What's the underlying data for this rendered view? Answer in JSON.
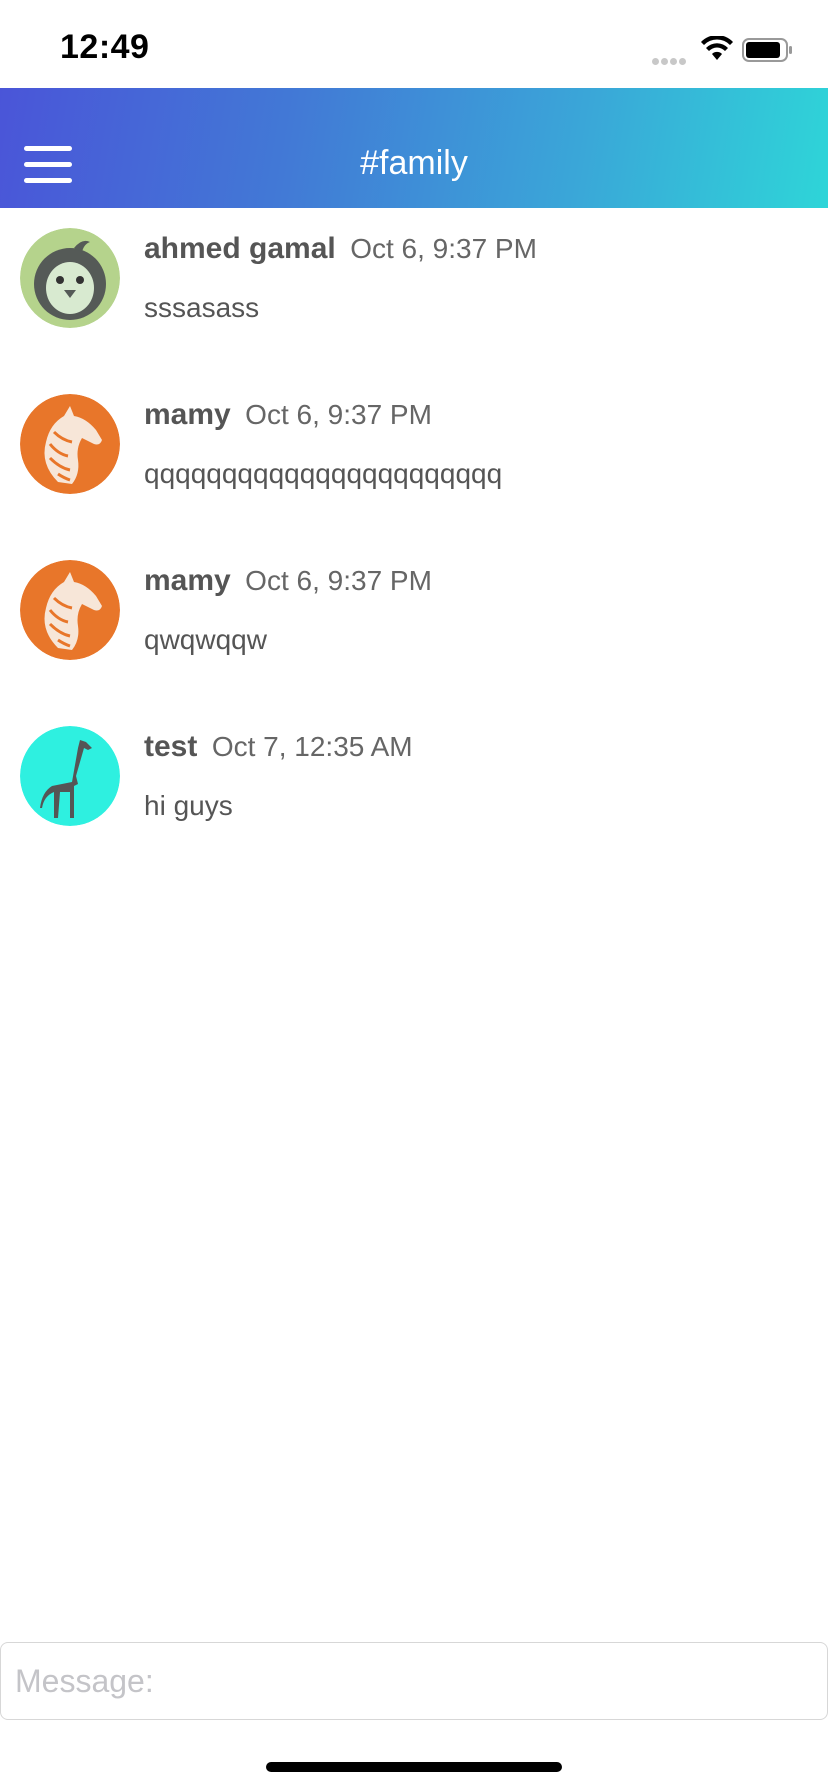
{
  "status_bar": {
    "time": "12:49"
  },
  "header": {
    "title": "#family",
    "gradient_start": "#4a55d8",
    "gradient_end": "#2ed5d8"
  },
  "messages": [
    {
      "author": "ahmed gamal",
      "time": "Oct 6, 9:37 PM",
      "text": "sssasass",
      "avatar": "penguin-icon",
      "avatar_color": "#b5d38c"
    },
    {
      "author": "mamy",
      "time": "Oct 6, 9:37 PM",
      "text": "qqqqqqqqqqqqqqqqqqqqqqq",
      "avatar": "horse-icon",
      "avatar_color": "#e8762a"
    },
    {
      "author": "mamy",
      "time": "Oct 6, 9:37 PM",
      "text": "qwqwqqw",
      "avatar": "horse-icon",
      "avatar_color": "#e8762a"
    },
    {
      "author": "test",
      "time": "Oct 7, 12:35 AM",
      "text": "hi guys",
      "avatar": "giraffe-icon",
      "avatar_color": "#2ef0e0"
    }
  ],
  "composer": {
    "placeholder": "Message:",
    "value": ""
  }
}
